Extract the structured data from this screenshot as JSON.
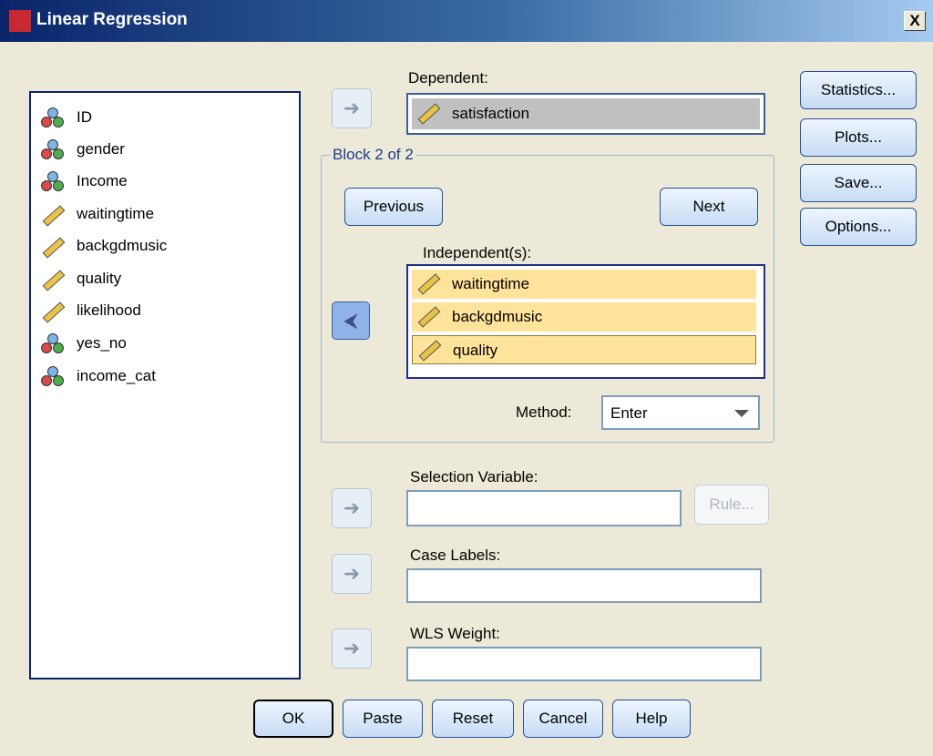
{
  "window": {
    "title": "Linear Regression",
    "close_label": "X"
  },
  "variables": [
    {
      "name": "ID",
      "icon": "nominal-icon"
    },
    {
      "name": "gender",
      "icon": "nominal-icon"
    },
    {
      "name": "Income",
      "icon": "nominal-icon"
    },
    {
      "name": "waitingtime",
      "icon": "scale-icon"
    },
    {
      "name": "backgdmusic",
      "icon": "scale-icon"
    },
    {
      "name": "quality",
      "icon": "scale-icon"
    },
    {
      "name": "likelihood",
      "icon": "scale-icon"
    },
    {
      "name": "yes_no",
      "icon": "nominal-icon"
    },
    {
      "name": "income_cat",
      "icon": "nominal-icon"
    }
  ],
  "dependent": {
    "label": "Dependent:",
    "value": "satisfaction"
  },
  "block": {
    "label": "Block 2 of 2",
    "previous_label": "Previous",
    "next_label": "Next",
    "independents_label": "Independent(s):",
    "independents": [
      "waitingtime",
      "backgdmusic",
      "quality"
    ],
    "method_label": "Method:",
    "method_value": "Enter"
  },
  "selection": {
    "label": "Selection Variable:",
    "value": "",
    "rule_label": "Rule..."
  },
  "case_labels": {
    "label": "Case Labels:",
    "value": ""
  },
  "wls": {
    "label": "WLS Weight:",
    "value": ""
  },
  "side_buttons": {
    "statistics": "Statistics...",
    "plots": "Plots...",
    "save": "Save...",
    "options": "Options..."
  },
  "footer": {
    "ok": "OK",
    "paste": "Paste",
    "reset": "Reset",
    "cancel": "Cancel",
    "help": "Help"
  },
  "colors": {
    "titlebar": "#0a246a",
    "selected_item": "#ffe39a",
    "dialog_bg": "#ece9d8"
  }
}
